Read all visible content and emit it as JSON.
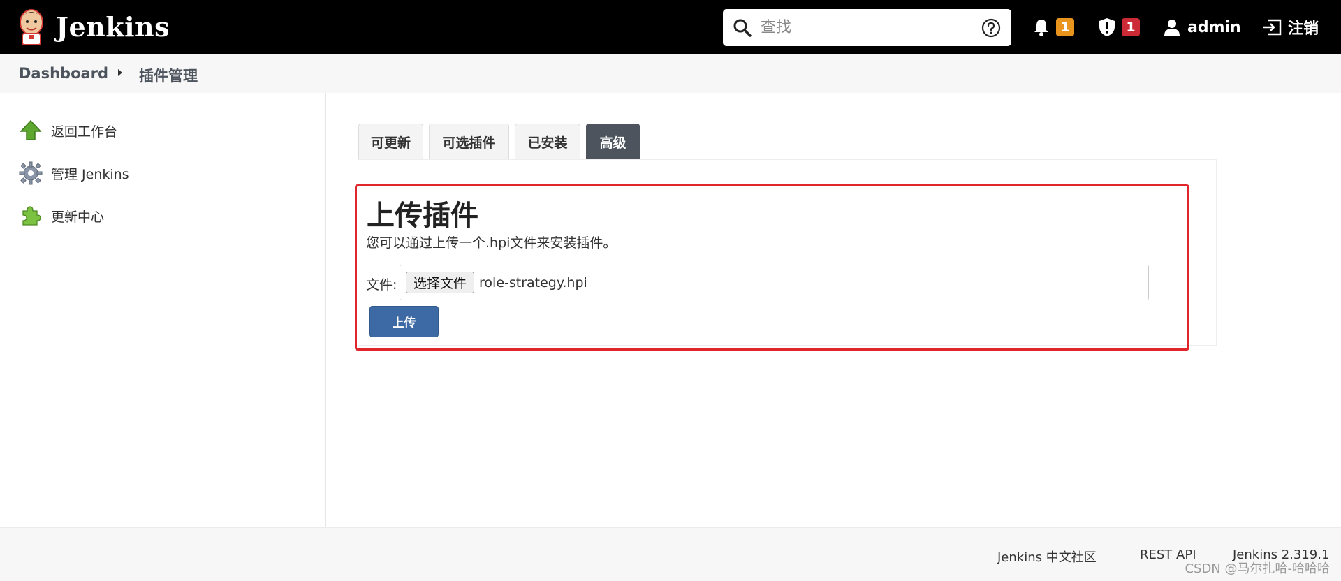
{
  "header": {
    "brand": "Jenkins",
    "search_placeholder": "查找",
    "notifications_count": "1",
    "security_count": "1",
    "user": "admin",
    "logout": "注销"
  },
  "breadcrumb": {
    "root": "Dashboard",
    "current": "插件管理"
  },
  "sidebar": {
    "items": [
      {
        "label": "返回工作台",
        "icon": "up-arrow-icon"
      },
      {
        "label": "管理 Jenkins",
        "icon": "gear-icon"
      },
      {
        "label": "更新中心",
        "icon": "puzzle-icon"
      }
    ]
  },
  "tabs": [
    {
      "label": "可更新",
      "active": false
    },
    {
      "label": "可选插件",
      "active": false
    },
    {
      "label": "已安装",
      "active": false
    },
    {
      "label": "高级",
      "active": true
    }
  ],
  "upload": {
    "title": "上传插件",
    "description": "您可以通过上传一个.hpi文件来安装插件。",
    "file_label": "文件:",
    "choose_button": "选择文件",
    "file_name": "role-strategy.hpi",
    "submit": "上传"
  },
  "footer": {
    "community": "Jenkins 中文社区",
    "rest_api": "REST API",
    "version": "Jenkins 2.319.1",
    "watermark": "CSDN @马尔扎哈-哈哈哈"
  },
  "colors": {
    "header_bg": "#000000",
    "active_tab": "#4d545d",
    "primary_button": "#3d6aa5",
    "highlight_border": "#e0262a",
    "badge_orange": "#e8941d",
    "badge_red": "#cc2a36"
  }
}
